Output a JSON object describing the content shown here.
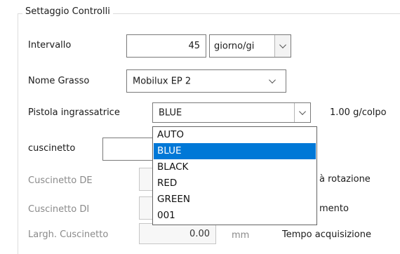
{
  "group": {
    "title": "Settaggio Controlli"
  },
  "intervallo": {
    "label": "Intervallo",
    "value": "45",
    "unit_value": "giorno/gi"
  },
  "nome_grasso": {
    "label": "Nome Grasso",
    "value": "Mobilux EP 2"
  },
  "pistola": {
    "label": "Pistola ingrassatrice",
    "value": "BLUE",
    "rate": "1.00 g/colpo",
    "options": [
      {
        "label": "AUTO",
        "selected": false
      },
      {
        "label": "BLUE",
        "selected": true
      },
      {
        "label": "BLACK",
        "selected": false
      },
      {
        "label": "RED",
        "selected": false
      },
      {
        "label": "GREEN",
        "selected": false
      },
      {
        "label": "001",
        "selected": false
      }
    ]
  },
  "cuscinetto": {
    "label": "cuscinetto",
    "value": ""
  },
  "cuscinetto_de": {
    "label": "Cuscinetto DE",
    "side_label": "à rotazione"
  },
  "cuscinetto_di": {
    "label": "Cuscinetto DI",
    "side_label": "mento"
  },
  "larghezza": {
    "label": "Largh.  Cuscinetto",
    "value": "0.00",
    "unit": "mm"
  },
  "tempo": {
    "label": "Tempo acquisizione"
  },
  "colors": {
    "selection": "#0078d7",
    "disabled_text": "#8a8a8a"
  }
}
